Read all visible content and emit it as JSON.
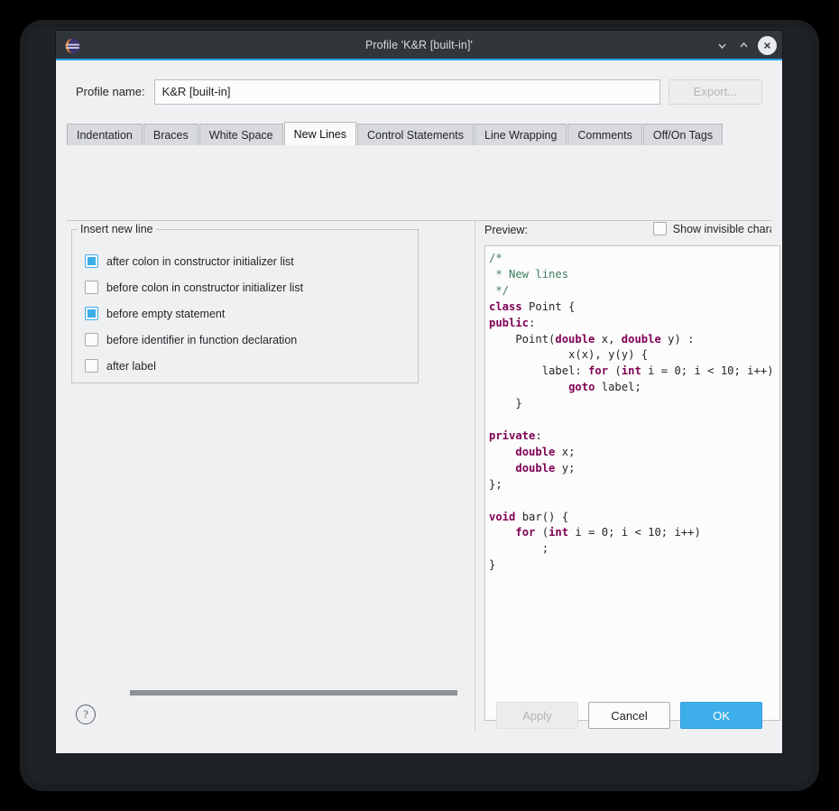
{
  "window": {
    "title": "Profile 'K&R [built-in]'",
    "app_icon": "eclipse-icon",
    "minimize_icon": "chevron-down-icon",
    "maximize_icon": "chevron-up-icon",
    "close_icon": "close-icon"
  },
  "profile": {
    "label": "Profile name:",
    "value": "K&R [built-in]",
    "placeholder": "",
    "export_label": "Export..."
  },
  "tabs": [
    {
      "label": "Indentation",
      "active": false
    },
    {
      "label": "Braces",
      "active": false
    },
    {
      "label": "White Space",
      "active": false
    },
    {
      "label": "New Lines",
      "active": true
    },
    {
      "label": "Control Statements",
      "active": false
    },
    {
      "label": "Line Wrapping",
      "active": false
    },
    {
      "label": "Comments",
      "active": false
    },
    {
      "label": "Off/On Tags",
      "active": false
    }
  ],
  "left_pane": {
    "group_title": "Insert new line",
    "options": [
      {
        "label": "after colon in constructor initializer list",
        "checked": true
      },
      {
        "label": "before colon in constructor initializer list",
        "checked": false
      },
      {
        "label": "before empty statement",
        "checked": true
      },
      {
        "label": "before identifier in function declaration",
        "checked": false
      },
      {
        "label": "after label",
        "checked": false
      }
    ]
  },
  "right_pane": {
    "preview_label": "Preview:",
    "show_invisible_label": "Show invisible charac",
    "show_invisible_checked": false,
    "code_lines": [
      [
        {
          "t": "/*",
          "c": "cm"
        }
      ],
      [
        {
          "t": " * New lines",
          "c": "cm"
        }
      ],
      [
        {
          "t": " */",
          "c": "cm"
        }
      ],
      [
        {
          "t": "class",
          "c": "kw"
        },
        {
          "t": " Point {",
          "c": ""
        }
      ],
      [
        {
          "t": "public",
          "c": "kw"
        },
        {
          "t": ":",
          "c": ""
        }
      ],
      [
        {
          "t": "    Point(",
          "c": ""
        },
        {
          "t": "double",
          "c": "kw"
        },
        {
          "t": " x, ",
          "c": ""
        },
        {
          "t": "double",
          "c": "kw"
        },
        {
          "t": " y) :",
          "c": ""
        }
      ],
      [
        {
          "t": "            x(x), y(y) {",
          "c": ""
        }
      ],
      [
        {
          "t": "        label: ",
          "c": ""
        },
        {
          "t": "for",
          "c": "kw"
        },
        {
          "t": " (",
          "c": ""
        },
        {
          "t": "int",
          "c": "kw"
        },
        {
          "t": " i = 0; i < 10; i++)",
          "c": ""
        }
      ],
      [
        {
          "t": "            ",
          "c": ""
        },
        {
          "t": "goto",
          "c": "kw"
        },
        {
          "t": " label;",
          "c": ""
        }
      ],
      [
        {
          "t": "    }",
          "c": ""
        }
      ],
      [
        {
          "t": "",
          "c": ""
        }
      ],
      [
        {
          "t": "private",
          "c": "kw"
        },
        {
          "t": ":",
          "c": ""
        }
      ],
      [
        {
          "t": "    ",
          "c": ""
        },
        {
          "t": "double",
          "c": "kw"
        },
        {
          "t": " x;",
          "c": ""
        }
      ],
      [
        {
          "t": "    ",
          "c": ""
        },
        {
          "t": "double",
          "c": "kw"
        },
        {
          "t": " y;",
          "c": ""
        }
      ],
      [
        {
          "t": "};",
          "c": ""
        }
      ],
      [
        {
          "t": "",
          "c": ""
        }
      ],
      [
        {
          "t": "void",
          "c": "kw"
        },
        {
          "t": " bar() {",
          "c": ""
        }
      ],
      [
        {
          "t": "    ",
          "c": ""
        },
        {
          "t": "for",
          "c": "kw"
        },
        {
          "t": " (",
          "c": ""
        },
        {
          "t": "int",
          "c": "kw"
        },
        {
          "t": " i = 0; i < 10; i++)",
          "c": ""
        }
      ],
      [
        {
          "t": "        ;",
          "c": ""
        }
      ],
      [
        {
          "t": "}",
          "c": ""
        }
      ]
    ]
  },
  "footer": {
    "help_icon": "help-question-icon",
    "apply_label": "Apply",
    "cancel_label": "Cancel",
    "ok_label": "OK"
  },
  "colors": {
    "accent": "#3daee9",
    "titlebar": "#31363b",
    "dialog_bg": "#eff0f1",
    "keyword": "#7f0055",
    "comment": "#3f7f5f"
  }
}
